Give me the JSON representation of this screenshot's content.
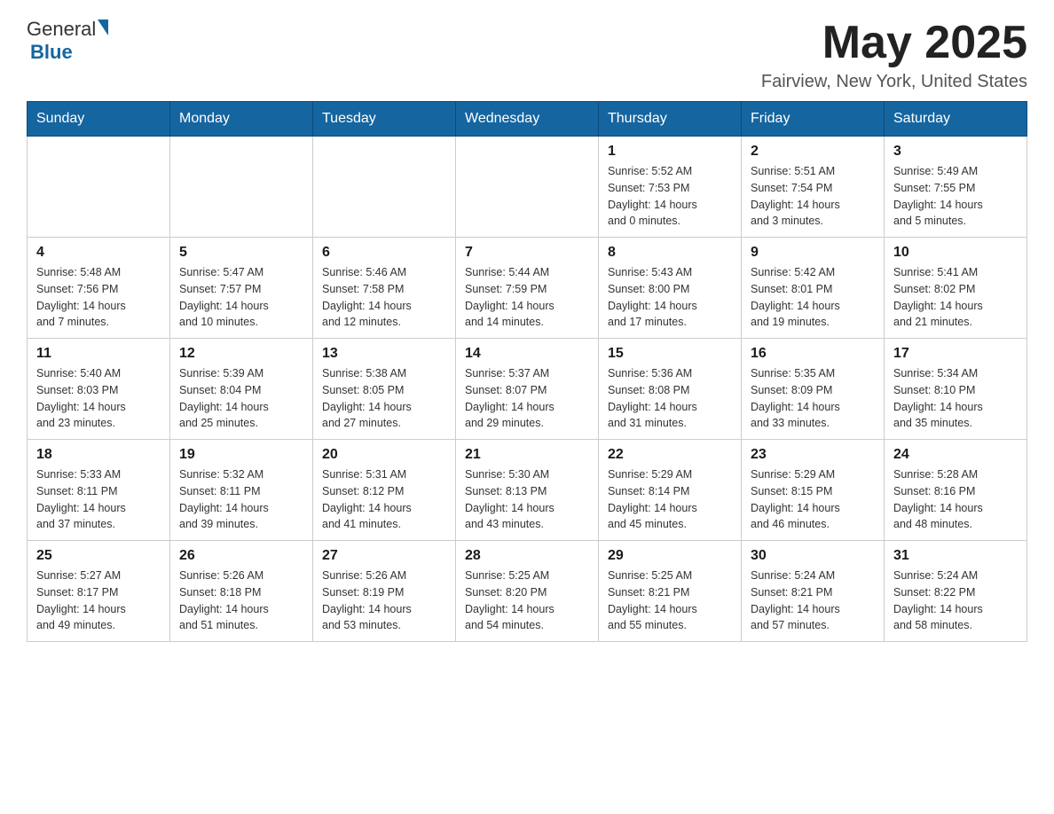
{
  "header": {
    "logo_general": "General",
    "logo_blue": "Blue",
    "month_title": "May 2025",
    "location": "Fairview, New York, United States"
  },
  "days_of_week": [
    "Sunday",
    "Monday",
    "Tuesday",
    "Wednesday",
    "Thursday",
    "Friday",
    "Saturday"
  ],
  "weeks": [
    [
      {
        "day": "",
        "info": ""
      },
      {
        "day": "",
        "info": ""
      },
      {
        "day": "",
        "info": ""
      },
      {
        "day": "",
        "info": ""
      },
      {
        "day": "1",
        "info": "Sunrise: 5:52 AM\nSunset: 7:53 PM\nDaylight: 14 hours\nand 0 minutes."
      },
      {
        "day": "2",
        "info": "Sunrise: 5:51 AM\nSunset: 7:54 PM\nDaylight: 14 hours\nand 3 minutes."
      },
      {
        "day": "3",
        "info": "Sunrise: 5:49 AM\nSunset: 7:55 PM\nDaylight: 14 hours\nand 5 minutes."
      }
    ],
    [
      {
        "day": "4",
        "info": "Sunrise: 5:48 AM\nSunset: 7:56 PM\nDaylight: 14 hours\nand 7 minutes."
      },
      {
        "day": "5",
        "info": "Sunrise: 5:47 AM\nSunset: 7:57 PM\nDaylight: 14 hours\nand 10 minutes."
      },
      {
        "day": "6",
        "info": "Sunrise: 5:46 AM\nSunset: 7:58 PM\nDaylight: 14 hours\nand 12 minutes."
      },
      {
        "day": "7",
        "info": "Sunrise: 5:44 AM\nSunset: 7:59 PM\nDaylight: 14 hours\nand 14 minutes."
      },
      {
        "day": "8",
        "info": "Sunrise: 5:43 AM\nSunset: 8:00 PM\nDaylight: 14 hours\nand 17 minutes."
      },
      {
        "day": "9",
        "info": "Sunrise: 5:42 AM\nSunset: 8:01 PM\nDaylight: 14 hours\nand 19 minutes."
      },
      {
        "day": "10",
        "info": "Sunrise: 5:41 AM\nSunset: 8:02 PM\nDaylight: 14 hours\nand 21 minutes."
      }
    ],
    [
      {
        "day": "11",
        "info": "Sunrise: 5:40 AM\nSunset: 8:03 PM\nDaylight: 14 hours\nand 23 minutes."
      },
      {
        "day": "12",
        "info": "Sunrise: 5:39 AM\nSunset: 8:04 PM\nDaylight: 14 hours\nand 25 minutes."
      },
      {
        "day": "13",
        "info": "Sunrise: 5:38 AM\nSunset: 8:05 PM\nDaylight: 14 hours\nand 27 minutes."
      },
      {
        "day": "14",
        "info": "Sunrise: 5:37 AM\nSunset: 8:07 PM\nDaylight: 14 hours\nand 29 minutes."
      },
      {
        "day": "15",
        "info": "Sunrise: 5:36 AM\nSunset: 8:08 PM\nDaylight: 14 hours\nand 31 minutes."
      },
      {
        "day": "16",
        "info": "Sunrise: 5:35 AM\nSunset: 8:09 PM\nDaylight: 14 hours\nand 33 minutes."
      },
      {
        "day": "17",
        "info": "Sunrise: 5:34 AM\nSunset: 8:10 PM\nDaylight: 14 hours\nand 35 minutes."
      }
    ],
    [
      {
        "day": "18",
        "info": "Sunrise: 5:33 AM\nSunset: 8:11 PM\nDaylight: 14 hours\nand 37 minutes."
      },
      {
        "day": "19",
        "info": "Sunrise: 5:32 AM\nSunset: 8:11 PM\nDaylight: 14 hours\nand 39 minutes."
      },
      {
        "day": "20",
        "info": "Sunrise: 5:31 AM\nSunset: 8:12 PM\nDaylight: 14 hours\nand 41 minutes."
      },
      {
        "day": "21",
        "info": "Sunrise: 5:30 AM\nSunset: 8:13 PM\nDaylight: 14 hours\nand 43 minutes."
      },
      {
        "day": "22",
        "info": "Sunrise: 5:29 AM\nSunset: 8:14 PM\nDaylight: 14 hours\nand 45 minutes."
      },
      {
        "day": "23",
        "info": "Sunrise: 5:29 AM\nSunset: 8:15 PM\nDaylight: 14 hours\nand 46 minutes."
      },
      {
        "day": "24",
        "info": "Sunrise: 5:28 AM\nSunset: 8:16 PM\nDaylight: 14 hours\nand 48 minutes."
      }
    ],
    [
      {
        "day": "25",
        "info": "Sunrise: 5:27 AM\nSunset: 8:17 PM\nDaylight: 14 hours\nand 49 minutes."
      },
      {
        "day": "26",
        "info": "Sunrise: 5:26 AM\nSunset: 8:18 PM\nDaylight: 14 hours\nand 51 minutes."
      },
      {
        "day": "27",
        "info": "Sunrise: 5:26 AM\nSunset: 8:19 PM\nDaylight: 14 hours\nand 53 minutes."
      },
      {
        "day": "28",
        "info": "Sunrise: 5:25 AM\nSunset: 8:20 PM\nDaylight: 14 hours\nand 54 minutes."
      },
      {
        "day": "29",
        "info": "Sunrise: 5:25 AM\nSunset: 8:21 PM\nDaylight: 14 hours\nand 55 minutes."
      },
      {
        "day": "30",
        "info": "Sunrise: 5:24 AM\nSunset: 8:21 PM\nDaylight: 14 hours\nand 57 minutes."
      },
      {
        "day": "31",
        "info": "Sunrise: 5:24 AM\nSunset: 8:22 PM\nDaylight: 14 hours\nand 58 minutes."
      }
    ]
  ]
}
